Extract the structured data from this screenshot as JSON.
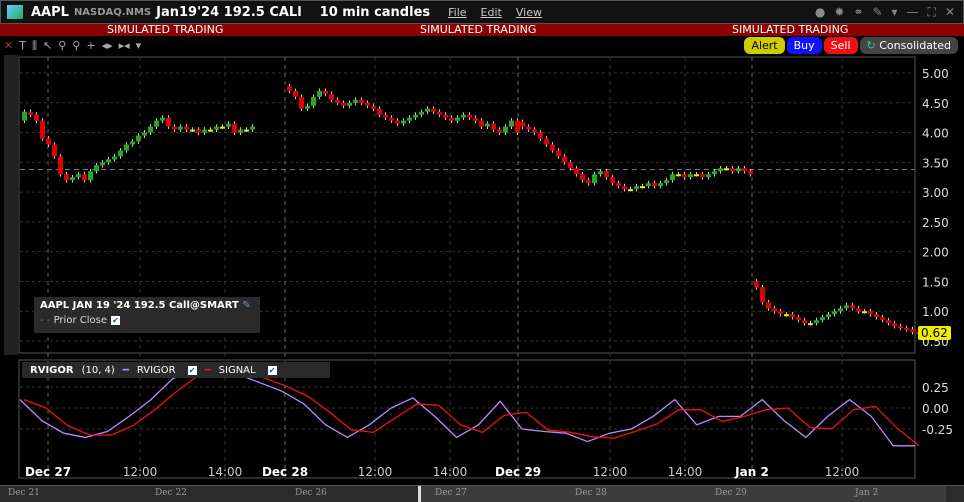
{
  "header": {
    "symbol": "AAPL",
    "exchange": "NASDAQ.NMS",
    "contract": "Jan19'24 192.5 CALl",
    "timeframe": "10 min candles",
    "menu": [
      "File",
      "Edit",
      "View"
    ]
  },
  "sim_banner": "SIMULATED TRADING",
  "buttons": {
    "alert": "Alert",
    "buy": "Buy",
    "sell": "Sell",
    "consolidated": "Consolidated"
  },
  "colors": {
    "up": "#22aa22",
    "down": "#dd0000",
    "flat": "#eeee00",
    "rvigor": "#bb88ff",
    "signal": "#ee1111",
    "sim": "#8b0000"
  },
  "legend": {
    "title": "AAPL JAN 19 '24 192.5 Call@SMART",
    "prior_close": "Prior Close"
  },
  "indicator": {
    "name": "RVIGOR",
    "params": "(10, 4)",
    "line1": "RVIGOR",
    "line2": "SIGNAL"
  },
  "last_price": "0.62",
  "price_ticks": [
    "5.00",
    "4.50",
    "4.00",
    "3.50",
    "3.00",
    "2.50",
    "2.00",
    "1.50",
    "1.00",
    "0.50"
  ],
  "ind_ticks": [
    "0.25",
    "0.00",
    "-0.25"
  ],
  "time_ticks": [
    {
      "l": "Dec 27",
      "b": true
    },
    {
      "l": "12:00"
    },
    {
      "l": "14:00"
    },
    {
      "l": "Dec 28",
      "b": true
    },
    {
      "l": "12:00"
    },
    {
      "l": "14:00"
    },
    {
      "l": "Dec 29",
      "b": true
    },
    {
      "l": "12:00"
    },
    {
      "l": "14:00"
    },
    {
      "l": "Jan 2",
      "b": true
    },
    {
      "l": "12:00"
    }
  ],
  "scroller_ticks": [
    "Dec 21",
    "Dec 22",
    "Dec 26",
    "Dec 27",
    "Dec 28",
    "Dec 29",
    "Jan 2"
  ],
  "chart_data": {
    "type": "candlestick",
    "prior_close": 3.38,
    "closes": [
      [
        4.35,
        4.3,
        4.2,
        3.9,
        3.8,
        3.6,
        3.3,
        3.2,
        3.25,
        3.3,
        3.2,
        3.35,
        3.45,
        3.5,
        3.55,
        3.6,
        3.7,
        3.8,
        3.85,
        3.95,
        4.0,
        4.1,
        4.2,
        4.25,
        4.1,
        4.05,
        4.1,
        4.05,
        4.05,
        4.0,
        4.05,
        4.05,
        4.1,
        4.1,
        4.15,
        4.0,
        4.05,
        4.05,
        4.1
      ],
      [
        4.7,
        4.6,
        4.4,
        4.45,
        4.6,
        4.7,
        4.65,
        4.55,
        4.5,
        4.45,
        4.5,
        4.55,
        4.5,
        4.45,
        4.4,
        4.3,
        4.25,
        4.2,
        4.15,
        4.2,
        4.25,
        4.3,
        4.35,
        4.4,
        4.35,
        4.3,
        4.25,
        4.2,
        4.25,
        4.3,
        4.25,
        4.2,
        4.1,
        4.15,
        4.05,
        4.0,
        4.1,
        4.2,
        4.0
      ],
      [
        4.1,
        4.05,
        4.0,
        3.9,
        3.8,
        3.7,
        3.6,
        3.5,
        3.4,
        3.3,
        3.2,
        3.15,
        3.3,
        3.35,
        3.25,
        3.15,
        3.1,
        3.05,
        3.05,
        3.1,
        3.1,
        3.15,
        3.1,
        3.15,
        3.2,
        3.3,
        3.3,
        3.25,
        3.3,
        3.3,
        3.25,
        3.3,
        3.35,
        3.4,
        3.4,
        3.35,
        3.4,
        3.35,
        3.3
      ],
      [
        1.4,
        1.15,
        1.05,
        1.0,
        0.95,
        0.95,
        0.9,
        0.85,
        0.8,
        0.8,
        0.85,
        0.9,
        0.95,
        1.0,
        1.05,
        1.1,
        1.05,
        1.0,
        1.0,
        0.95,
        0.9,
        0.85,
        0.8,
        0.75,
        0.72,
        0.7,
        0.65,
        0.62
      ]
    ],
    "rvigor": [
      0.1,
      -0.15,
      -0.3,
      -0.35,
      -0.28,
      -0.1,
      0.1,
      0.35,
      0.45,
      0.45,
      0.4,
      0.3,
      0.2,
      0.05,
      -0.2,
      -0.35,
      -0.2,
      0.0,
      0.12,
      -0.1,
      -0.35,
      -0.2,
      0.08,
      -0.25,
      -0.28,
      -0.3,
      -0.4,
      -0.3,
      -0.25,
      -0.1,
      0.1,
      -0.2,
      -0.1,
      -0.1,
      0.1,
      -0.15,
      -0.35,
      -0.1,
      0.1,
      -0.1,
      -0.45,
      -0.45
    ]
  }
}
